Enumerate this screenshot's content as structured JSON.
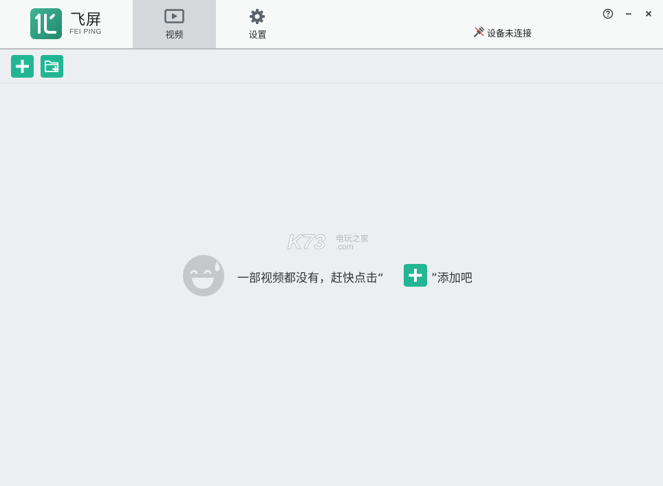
{
  "app": {
    "title": "飞屏",
    "subtitle": "FEI PING",
    "brand_color": "#22b693"
  },
  "nav": {
    "tabs": [
      {
        "label": "视频",
        "icon": "play-icon",
        "active": true
      },
      {
        "label": "设置",
        "icon": "gear-icon",
        "active": false
      }
    ]
  },
  "device": {
    "status": "设备未连接",
    "icon": "plug-disconnected-icon"
  },
  "window_controls": {
    "help_icon": "help-icon",
    "minimize_icon": "minimize-icon",
    "close_icon": "close-icon"
  },
  "toolbar": {
    "add_icon": "add-icon",
    "add_folder_icon": "add-folder-icon"
  },
  "empty_state": {
    "message": "一部视频都没有，赶快点击“",
    "message_end": "”添加吧",
    "face_icon": "sweat-smile-face-icon"
  },
  "watermark": {
    "main": "K73",
    "cn": "电玩之家",
    "domain": ".com"
  }
}
